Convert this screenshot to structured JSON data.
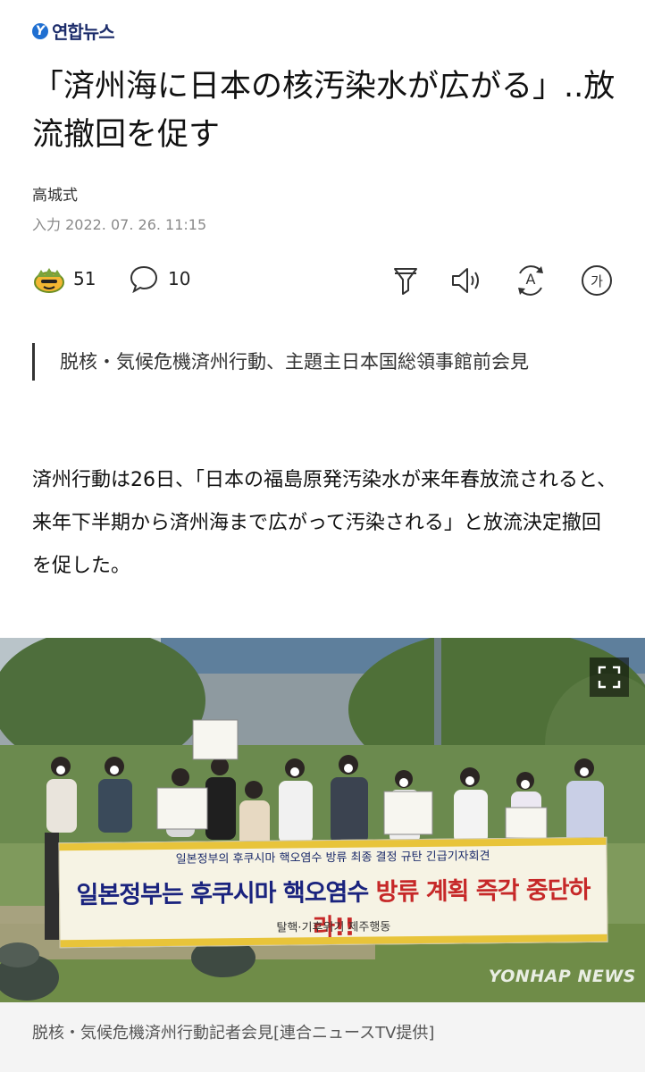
{
  "brand": {
    "name": "연합뉴스",
    "color": "#1d2d6b"
  },
  "article": {
    "headline": "「済州海に日本の核汚染水が広がる」..放流撤回を促す",
    "author": "高城式",
    "date": "入力 2022. 07. 26. 11:15",
    "subheadline": "脱核・気候危機済州行動、主題主日本国総領事館前会見",
    "body": "済州行動は26日、「日本の福島原発汚染水が来年春放流されると、来年下半期から済州海まで広がって汚染される」と放流決定撤回を促した。"
  },
  "actions": {
    "reactions_count": "51",
    "comments_count": "10",
    "icons": [
      "reaction-icon",
      "comment-icon",
      "filter-icon",
      "speaker-icon",
      "translate-icon",
      "font-size-icon"
    ],
    "font_size_label": "가",
    "translate_label": "A"
  },
  "photo": {
    "banner_top": "일본정부의 후쿠시마 핵오염수 방류 최종 결정 규탄 긴급기자회견",
    "banner_main_part1": "일본정부는 후쿠시마 핵오염수 ",
    "banner_main_part2": "방류 계획 즉각 중단하라!!",
    "banner_bottom": "탈핵·기후위기 제주행동",
    "watermark": "YONHAP NEWS",
    "caption": "脱核・気候危機済州行動記者会見[連合ニュースTV提供]"
  }
}
